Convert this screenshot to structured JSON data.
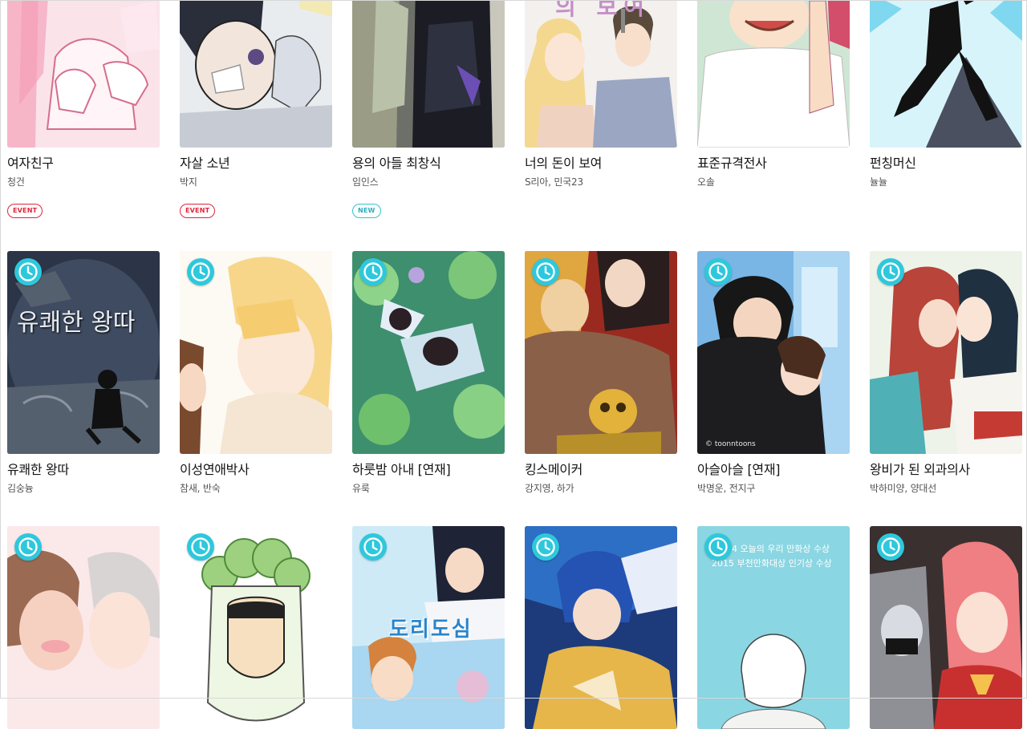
{
  "colors": {
    "clock_badge": "#2ec8dc",
    "event_badge": "#e0243a",
    "new_badge": "#35c2cf"
  },
  "row1": [
    {
      "title": "여자친구",
      "author": "청건",
      "badge": "EVENT"
    },
    {
      "title": "자살 소년",
      "author": "박지",
      "badge": "EVENT"
    },
    {
      "title": "용의 아들 최창식",
      "author": "임인스",
      "badge": "NEW"
    },
    {
      "title": "너의 돈이 보여",
      "author": "S리아, 민국23",
      "cover_text": "의 보여"
    },
    {
      "title": "표준규격전사",
      "author": "오솔"
    },
    {
      "title": "펀칭머신",
      "author": "뉼뉼"
    }
  ],
  "row2": [
    {
      "title": "유쾌한 왕따",
      "author": "김숭늉",
      "icon": "clock-icon",
      "cover_text": "유쾌한 왕따"
    },
    {
      "title": "이성연애박사",
      "author": "참새, 반숙",
      "icon": "clock-icon"
    },
    {
      "title": "하룻밤 아내 [연재]",
      "author": "유룩",
      "icon": "clock-icon"
    },
    {
      "title": "킹스메이커",
      "author": "강지영, 하가",
      "icon": "clock-icon"
    },
    {
      "title": "아슬아슬 [연재]",
      "author": "박명운, 전지구",
      "icon": "clock-icon",
      "cover_text": "© toonntoons"
    },
    {
      "title": "왕비가 된 외과의사",
      "author": "박하미양, 양대선",
      "icon": "clock-icon"
    }
  ],
  "row3": [
    {
      "icon": "clock-icon"
    },
    {
      "icon": "clock-icon"
    },
    {
      "icon": "clock-icon",
      "cover_text": "도리도심"
    },
    {
      "icon": "clock-icon"
    },
    {
      "icon": "clock-icon",
      "cover_text": "2014 오늘의 우리 만화상 수상",
      "cover_text2": "2015 부천만화대상 인기상 수상"
    },
    {
      "icon": "clock-icon"
    }
  ]
}
